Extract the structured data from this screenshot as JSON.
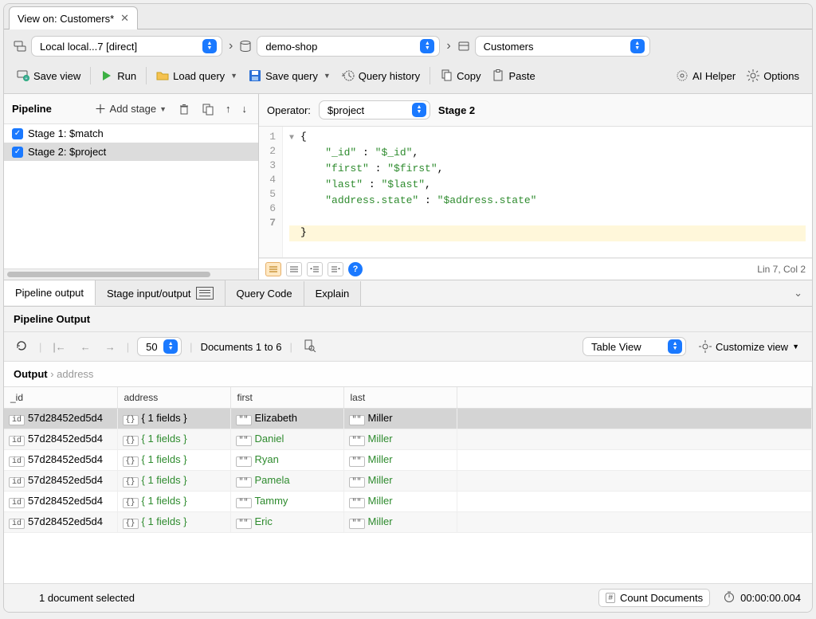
{
  "tab": {
    "title": "View on: Customers*"
  },
  "breadcrumb": {
    "connection": "Local local...7 [direct]",
    "database": "demo-shop",
    "collection": "Customers"
  },
  "toolbar": {
    "save_view": "Save view",
    "run": "Run",
    "load_query": "Load query",
    "save_query": "Save query",
    "query_history": "Query history",
    "copy": "Copy",
    "paste": "Paste",
    "ai_helper": "AI Helper",
    "options": "Options"
  },
  "pipeline": {
    "title": "Pipeline",
    "add_stage": "Add stage",
    "stages": [
      {
        "label": "Stage 1: $match",
        "checked": true,
        "selected": false
      },
      {
        "label": "Stage 2: $project",
        "checked": true,
        "selected": true
      }
    ]
  },
  "editor": {
    "operator_label": "Operator:",
    "operator_value": "$project",
    "stage_title": "Stage 2",
    "code_lines": [
      "{",
      "    \"_id\" : \"$_id\",",
      "    \"first\" : \"$first\",",
      "    \"last\" : \"$last\",",
      "    \"address.state\" : \"$address.state\"",
      "",
      "}"
    ],
    "cursor": "Lin 7, Col 2"
  },
  "output": {
    "tabs": {
      "pipeline_output": "Pipeline output",
      "stage_io": "Stage input/output",
      "query_code": "Query Code",
      "explain": "Explain"
    },
    "section_title": "Pipeline Output",
    "page_size": "50",
    "range": "Documents 1 to 6",
    "view_mode": "Table View",
    "customize": "Customize view",
    "crumb_root": "Output",
    "crumb_leaf": "address",
    "columns": [
      "_id",
      "address",
      "first",
      "last"
    ],
    "rows": [
      {
        "_id": "57d28452ed5d4",
        "address": "{ 1 fields }",
        "first": "Elizabeth",
        "last": "Miller",
        "selected": true
      },
      {
        "_id": "57d28452ed5d4",
        "address": "{ 1 fields }",
        "first": "Daniel",
        "last": "Miller",
        "selected": false
      },
      {
        "_id": "57d28452ed5d4",
        "address": "{ 1 fields }",
        "first": "Ryan",
        "last": "Miller",
        "selected": false
      },
      {
        "_id": "57d28452ed5d4",
        "address": "{ 1 fields }",
        "first": "Pamela",
        "last": "Miller",
        "selected": false
      },
      {
        "_id": "57d28452ed5d4",
        "address": "{ 1 fields }",
        "first": "Tammy",
        "last": "Miller",
        "selected": false
      },
      {
        "_id": "57d28452ed5d4",
        "address": "{ 1 fields }",
        "first": "Eric",
        "last": "Miller",
        "selected": false
      }
    ]
  },
  "status": {
    "selection": "1 document selected",
    "count_docs": "Count Documents",
    "elapsed": "00:00:00.004"
  }
}
